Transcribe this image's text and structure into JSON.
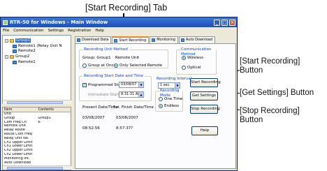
{
  "callouts": {
    "start_tab": "[Start Recording] Tab",
    "start_btn_line1": "[Start Recording]",
    "start_btn_line2": "Button",
    "get_settings": "[Get Settings] Button",
    "stop_btn_line1": "[Stop Recording]",
    "stop_btn_line2": "Button"
  },
  "window": {
    "title": "RTR-50 for Windows - Main Window",
    "menu": [
      "File",
      "Communication",
      "Settings",
      "Registration",
      "Help"
    ]
  },
  "tree": [
    {
      "label": "Group1",
      "kind": "group",
      "selected": true
    },
    {
      "label": "Remote1 (Relay Unit N",
      "kind": "unit"
    },
    {
      "label": "Remote2",
      "kind": "unit"
    },
    {
      "label": "Group2",
      "kind": "group"
    },
    {
      "label": "Remote1",
      "kind": "unit"
    }
  ],
  "props": {
    "headers": [
      "Item",
      "Contents"
    ],
    "rows": [
      [
        "Unit",
        ""
      ],
      [
        "Group",
        "Group1"
      ],
      [
        "Com Freq Ch",
        "6"
      ],
      [
        "Remote Unit",
        ""
      ],
      [
        "Relay Route",
        ""
      ],
      [
        "Route Com Freq",
        ""
      ],
      [
        "Relay Unit No.",
        ""
      ],
      [
        "Ch1 Upper Limit",
        ""
      ],
      [
        "Ch1 Lower Limit",
        ""
      ],
      [
        "Ch2 Upper Limit",
        ""
      ],
      [
        "Ch2 Lower Limit",
        ""
      ],
      [
        "Monitoring Int.",
        ""
      ],
      [
        "Auto Download",
        ""
      ]
    ]
  },
  "tabs": [
    "Download Data",
    "Start Recording",
    "Monitoring",
    "Auto Download"
  ],
  "panel": {
    "rec_unit_method": "Recording Unit Method",
    "group_label": "Group: Group1",
    "remote_unit_label": "Remote Unit",
    "radio_group_all": "Group at Once",
    "radio_selected": "Only Selected Remote",
    "comm_method": "Communication Method",
    "radio_wireless": "Wireless",
    "radio_optical": "Optical",
    "start_date_time": "Recording Start Date and Time",
    "programmed_start": "Programmed Start",
    "start_date": "03/08/07",
    "immediate_start": "Immediate Start",
    "start_time": "8:31:31 AM",
    "rec_interval": "Recording Interval",
    "interval_value": "1 sec",
    "rec_mode": "Recording Mode",
    "mode_one_time": "One Time",
    "mode_endless": "Endless",
    "present_dt": "Present Date/Time",
    "finish_dt": "Est. Finish Date/Time",
    "present_date": "03/08/2007",
    "present_time": "08:52:56",
    "finish_date": "03/08/2007",
    "finish_time": "8:57:37?"
  },
  "buttons": {
    "start": "Start Recording",
    "get_settings": "Get Settings",
    "stop": "Stop Recording",
    "help": "Help"
  }
}
